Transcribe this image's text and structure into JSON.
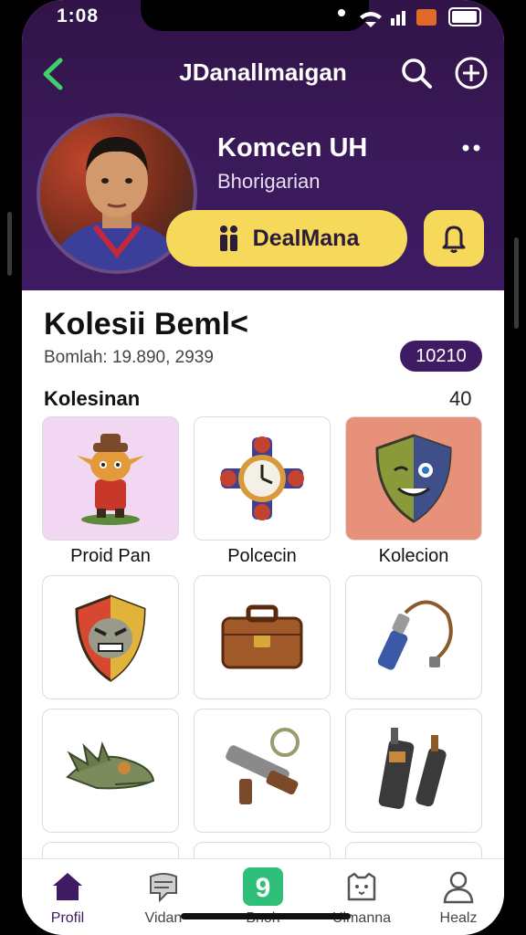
{
  "status": {
    "time": "1:08"
  },
  "header": {
    "title": "JDanallmaigan"
  },
  "profile": {
    "name": "Komcen UH",
    "subtitle": "Bhorigarian",
    "deal_button": "DealMana"
  },
  "collection": {
    "title": "Kolesii Beml<",
    "meta": "Bomlah: 19.890, 2939",
    "count_badge": "10210",
    "section_label": "Kolesinan",
    "section_count": "40"
  },
  "items": [
    {
      "label": "Proid Pan",
      "icon": "goblin-figure-icon"
    },
    {
      "label": "Polcecin",
      "icon": "gear-clock-icon"
    },
    {
      "label": "Kolecion",
      "icon": "mask-shield-icon"
    },
    {
      "label": "",
      "icon": "angry-shield-icon"
    },
    {
      "label": "",
      "icon": "briefcase-icon"
    },
    {
      "label": "",
      "icon": "flashlight-cord-icon"
    },
    {
      "label": "",
      "icon": "dragon-head-icon"
    },
    {
      "label": "",
      "icon": "blaster-gun-icon"
    },
    {
      "label": "",
      "icon": "walkie-talkie-icon"
    }
  ],
  "bottom_nav": [
    {
      "label": "Profil",
      "icon": "home-icon",
      "active": true
    },
    {
      "label": "Vidan",
      "icon": "chat-bubble-icon"
    },
    {
      "label": "Bnoh",
      "icon": "app-9-icon"
    },
    {
      "label": "Ulmanna",
      "icon": "cat-box-icon"
    },
    {
      "label": "Healz",
      "icon": "user-icon"
    }
  ],
  "colors": {
    "header_bg": "#3b1a5c",
    "accent_yellow": "#f6d85a",
    "pill_purple": "#3e1b62",
    "nav_green": "#2fbf7a"
  }
}
